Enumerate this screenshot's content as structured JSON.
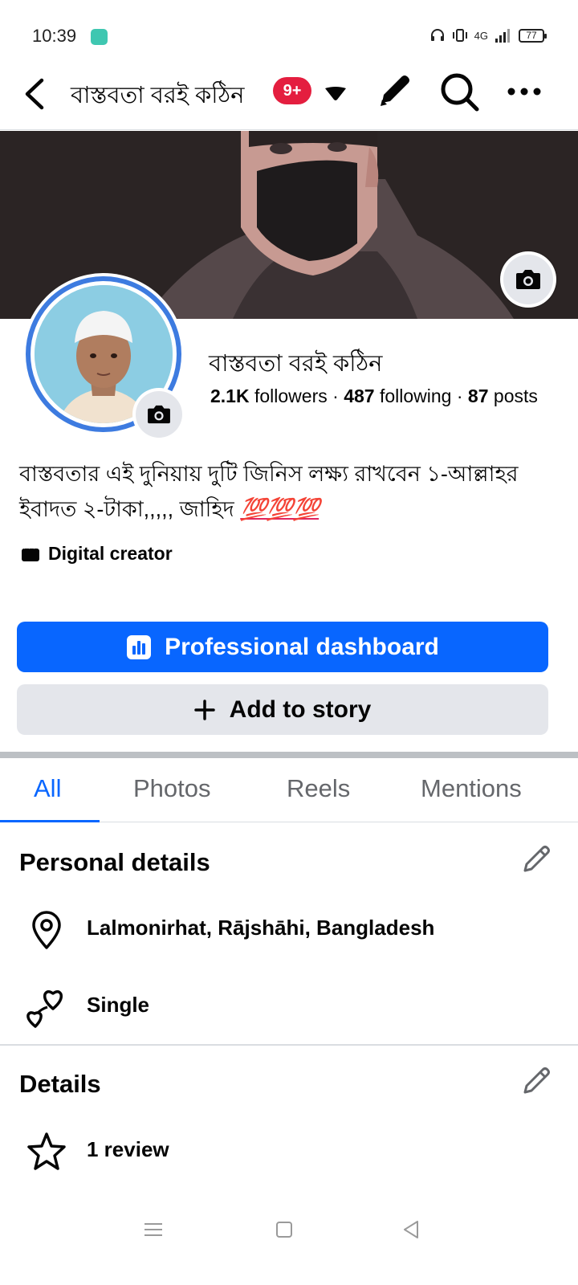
{
  "status_bar": {
    "time": "10:39",
    "network": "4G",
    "battery": "77"
  },
  "top_nav": {
    "title": "বাস্তবতা বরই কঠিন",
    "notification_count": "9+"
  },
  "profile": {
    "name": "বাস্তবতা বরই কঠিন",
    "followers_count": "2.1K",
    "followers_label": "followers",
    "following_count": "487",
    "following_label": "following",
    "posts_count": "87",
    "posts_label": "posts",
    "separator": "·",
    "bio": "বাস্তবতার এই দুনিয়ায় দুটি জিনিস লক্ষ্য রাখবেন ১-আল্লাহর ইবাদত ২-টাকা,,,,, জাহিদ",
    "bio_emoji": "💯💯💯",
    "category": "Digital creator"
  },
  "buttons": {
    "dashboard_label": "Professional dashboard",
    "story_label": "Add to story"
  },
  "tabs": [
    {
      "label": "All"
    },
    {
      "label": "Photos"
    },
    {
      "label": "Reels"
    },
    {
      "label": "Mentions"
    }
  ],
  "personal_details": {
    "title": "Personal details",
    "location": "Lalmonirhat, Rājshāhi, Bangladesh",
    "relationship": "Single"
  },
  "details": {
    "title": "Details",
    "reviews": "1 review"
  },
  "colors": {
    "accent": "#0866ff",
    "badge": "#e41e3f",
    "avatar_ring": "#3d7be0"
  }
}
